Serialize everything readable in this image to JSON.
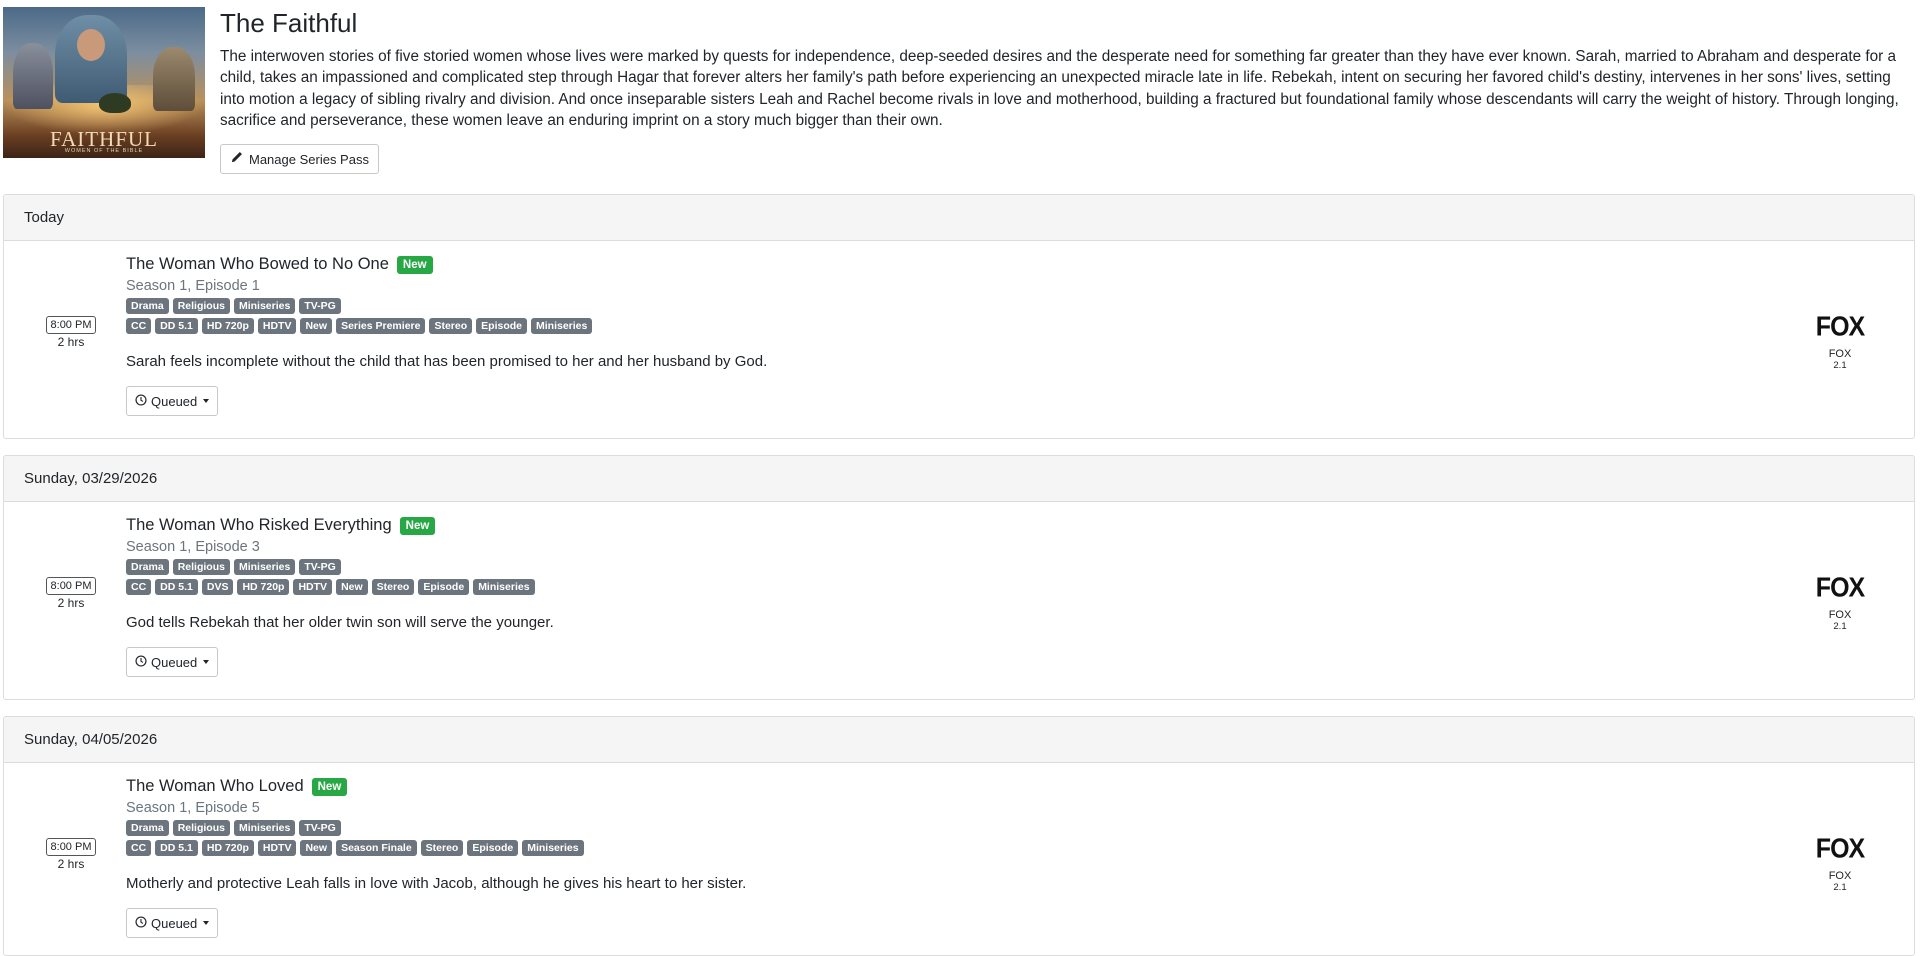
{
  "series": {
    "title": "The Faithful",
    "poster_title": "FAITHFUL",
    "poster_subtitle": "WOMEN OF THE BIBLE",
    "description": "The interwoven stories of five storied women whose lives were marked by quests for independence, deep-seeded desires and the desperate need for something far greater than they have ever known. Sarah, married to Abraham and desperate for a child, takes an impassioned and complicated step through Hagar that forever alters her family's path before experiencing an unexpected miracle late in life. Rebekah, intent on securing her favored child's destiny, intervenes in her sons' lives, setting into motion a legacy of sibling rivalry and division. And once inseparable sisters Leah and Rachel become rivals in love and motherhood, building a fractured but foundational family whose descendants will carry the weight of history. Through longing, sacrifice and perseverance, these women leave an enduring imprint on a story much bigger than their own.",
    "manage_label": "Manage Series Pass",
    "icons": {
      "manage": "pencil-icon",
      "queued": "clock-icon"
    }
  },
  "episodes": [
    {
      "date_header": "Today",
      "time": "8:00 PM",
      "duration": "2 hrs",
      "title": "The Woman Who Bowed to No One",
      "new_badge": "New",
      "season_episode": "Season 1, Episode 1",
      "genres": [
        "Drama",
        "Religious",
        "Miniseries",
        "TV-PG"
      ],
      "features": [
        "CC",
        "DD 5.1",
        "HD 720p",
        "HDTV",
        "New",
        "Series Premiere",
        "Stereo",
        "Episode",
        "Miniseries"
      ],
      "description": "Sarah feels incomplete without the child that has been promised to her and her husband by God.",
      "status": "Queued",
      "channel": {
        "logo": "FOX",
        "name": "FOX",
        "number": "2.1"
      }
    },
    {
      "date_header": "Sunday, 03/29/2026",
      "time": "8:00 PM",
      "duration": "2 hrs",
      "title": "The Woman Who Risked Everything",
      "new_badge": "New",
      "season_episode": "Season 1, Episode 3",
      "genres": [
        "Drama",
        "Religious",
        "Miniseries",
        "TV-PG"
      ],
      "features": [
        "CC",
        "DD 5.1",
        "DVS",
        "HD 720p",
        "HDTV",
        "New",
        "Stereo",
        "Episode",
        "Miniseries"
      ],
      "description": "God tells Rebekah that her older twin son will serve the younger.",
      "status": "Queued",
      "channel": {
        "logo": "FOX",
        "name": "FOX",
        "number": "2.1"
      }
    },
    {
      "date_header": "Sunday, 04/05/2026",
      "time": "8:00 PM",
      "duration": "2 hrs",
      "title": "The Woman Who Loved",
      "new_badge": "New",
      "season_episode": "Season 1, Episode 5",
      "genres": [
        "Drama",
        "Religious",
        "Miniseries",
        "TV-PG"
      ],
      "features": [
        "CC",
        "DD 5.1",
        "HD 720p",
        "HDTV",
        "New",
        "Season Finale",
        "Stereo",
        "Episode",
        "Miniseries"
      ],
      "description": "Motherly and protective Leah falls in love with Jacob, although he gives his heart to her sister.",
      "status": "Queued",
      "channel": {
        "logo": "FOX",
        "name": "FOX",
        "number": "2.1"
      }
    }
  ],
  "colors": {
    "new_badge": "#28a745",
    "tag": "#6c757d",
    "card_header": "#f5f5f5"
  }
}
